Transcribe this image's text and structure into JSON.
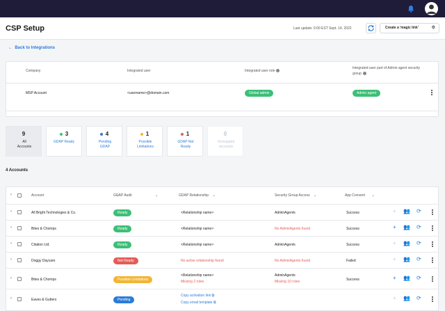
{
  "header": {
    "title": "CSP Setup",
    "last_update": "Last update: 9:00 EST Sept. 14, 2022",
    "magic_link_label": "Create a 'magic link'"
  },
  "nav": {
    "back_label": "Back to Integrations"
  },
  "integration": {
    "columns": [
      "Company",
      "Integrated user",
      "Integrated user role",
      "Integrated user part of Admin agent security group"
    ],
    "row": {
      "company": "MSP Account",
      "user": "<username>@domain.com",
      "role": "Global admin",
      "group": "Admin agent"
    }
  },
  "tiles": [
    {
      "count": "9",
      "label": "All Accounts"
    },
    {
      "count": "3",
      "label": "GDAP Ready"
    },
    {
      "count": "4",
      "label": "Pending GDAP"
    },
    {
      "count": "1",
      "label": "Possible Limitations"
    },
    {
      "count": "1",
      "label": "GDAP Not Ready"
    },
    {
      "count": "0",
      "label": "Unmapped accounts"
    }
  ],
  "accounts_count": "4 Accounts",
  "table": {
    "columns": [
      "Account",
      "GDAP Audit",
      "GDAP Relationship",
      "Security Group Access",
      "App Consent"
    ],
    "rows": [
      {
        "account": "All Bright Technologies & Co.",
        "audit": "Ready",
        "rel1": "<Relationship name>",
        "rel2": "",
        "sec1": "AdminAgents",
        "sec2": "",
        "consent": "Success"
      },
      {
        "account": "Bites & Chomps",
        "audit": "Ready",
        "rel1": "<Relationship name>",
        "rel2": "",
        "sec1": "No AdminAgents found",
        "sec2": "",
        "consent": "Success"
      },
      {
        "account": "Citation Ltd.",
        "audit": "Ready",
        "rel1": "<Relationship name>",
        "rel2": "",
        "sec1": "AdminAgents",
        "sec2": "",
        "consent": "Success"
      },
      {
        "account": "Doggy Daycare",
        "audit": "Not Ready",
        "rel1": "No active relationship found",
        "rel2": "",
        "sec1": "No AdminAgents found",
        "sec2": "",
        "consent": "Failed"
      },
      {
        "account": "Bites & Chomps",
        "audit": "Possible Limitations",
        "rel1": "<Relationship name>",
        "rel2": "Missing 2 roles",
        "sec1": "AdminAgents",
        "sec2": "Missing 10 roles",
        "consent": "Success"
      },
      {
        "account": "Eaves & Gutters",
        "audit": "Pending",
        "rel1": "Copy activation link",
        "rel2": "Copy email template",
        "sec1": "",
        "sec2": "",
        "consent": ""
      }
    ]
  },
  "colors": {
    "topbar": "#1f1c3a",
    "accent": "#2b7bd8",
    "ready": "#3cbf77",
    "not_ready": "#e45c57",
    "limitations": "#f2b534",
    "pending": "#2b7bd8"
  }
}
